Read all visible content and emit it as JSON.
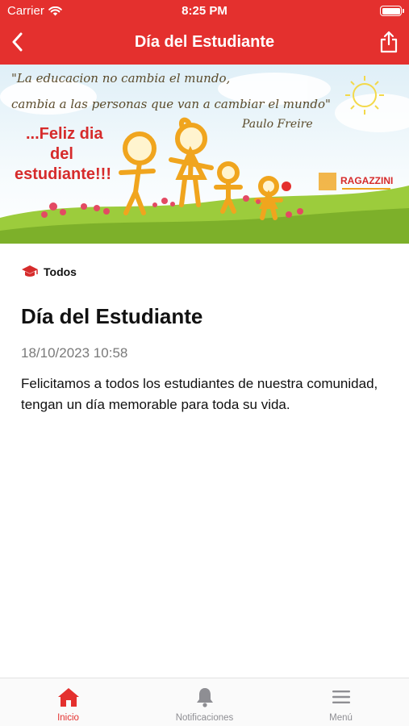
{
  "status_bar": {
    "carrier": "Carrier",
    "time": "8:25 PM"
  },
  "nav": {
    "title": "Día del Estudiante",
    "back_icon": "chevron-left-icon",
    "share_icon": "share-icon"
  },
  "banner": {
    "quote_line1": "\"La educacion no cambia el mundo,",
    "quote_line2": "cambia a las personas que van a cambiar el mundo\"",
    "quote_author": "Paulo Freire",
    "greeting_line1": "...Feliz dia",
    "greeting_line2": "del",
    "greeting_line3": "estudiante!!!",
    "logo_text": "RAGAZZINI"
  },
  "post": {
    "category": "Todos",
    "category_icon": "graduation-cap-icon",
    "title": "Día del Estudiante",
    "date": "18/10/2023 10:58",
    "body": "Felicitamos a todos los estudiantes de nuestra comunidad, tengan un día memorable para toda su vida."
  },
  "tabbar": {
    "tabs": [
      {
        "label": "Inicio",
        "icon": "home-icon",
        "active": true
      },
      {
        "label": "Notificaciones",
        "icon": "bell-icon",
        "active": false
      },
      {
        "label": "Menú",
        "icon": "menu-icon",
        "active": false
      }
    ]
  },
  "colors": {
    "accent": "#e4302e",
    "muted_text": "#7a7a7a",
    "inactive_tab": "#8e8e93"
  }
}
